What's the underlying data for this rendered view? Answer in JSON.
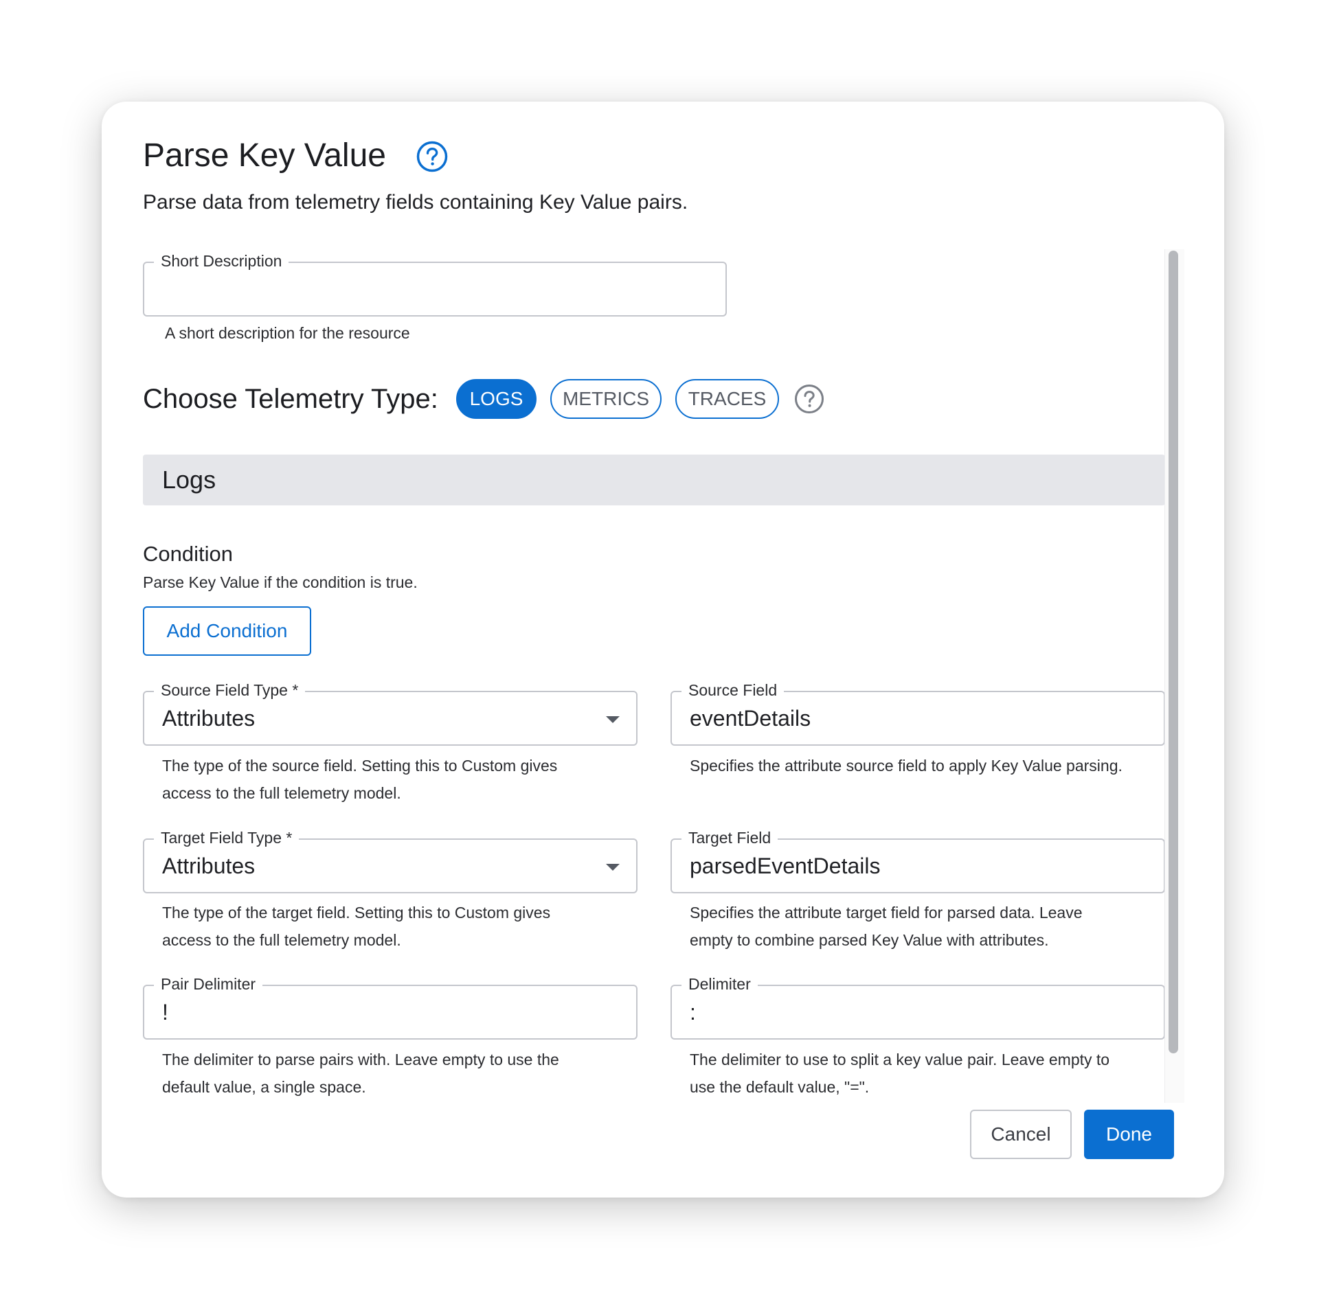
{
  "dialog": {
    "title": "Parse Key Value",
    "subtitle": "Parse data from telemetry fields containing Key Value pairs.",
    "help_icon": "question-circle-icon"
  },
  "short_description": {
    "label": "Short Description",
    "value": "",
    "helper": "A short description for the resource"
  },
  "telemetry": {
    "label": "Choose Telemetry Type:",
    "options": [
      "LOGS",
      "METRICS",
      "TRACES"
    ],
    "selected": "LOGS"
  },
  "section": {
    "title": "Logs"
  },
  "condition": {
    "title": "Condition",
    "description": "Parse Key Value if the condition is true.",
    "button_label": "Add Condition"
  },
  "fields": {
    "source_field_type": {
      "label": "Source Field Type *",
      "value": "Attributes",
      "helper_line1": "The type of the source field. Setting this to Custom gives",
      "helper_line2": "access to the full telemetry model."
    },
    "source_field": {
      "label": "Source Field",
      "value": "eventDetails",
      "helper_line1": "Specifies the attribute source field to apply Key Value parsing."
    },
    "target_field_type": {
      "label": "Target Field Type *",
      "value": "Attributes",
      "helper_line1": "The type of the target field. Setting this to Custom gives",
      "helper_line2": "access to the full telemetry model."
    },
    "target_field": {
      "label": "Target Field",
      "value": "parsedEventDetails",
      "helper_line1": "Specifies the attribute target field for parsed data. Leave",
      "helper_line2": "empty to combine parsed Key Value with attributes."
    },
    "pair_delimiter": {
      "label": "Pair Delimiter",
      "value": "!",
      "helper_line1": "The delimiter to parse pairs with. Leave empty to use the",
      "helper_line2": "default value, a single space."
    },
    "delimiter": {
      "label": "Delimiter",
      "value": ":",
      "helper_line1": "The delimiter to use to split a key value pair. Leave empty to",
      "helper_line2": "use the default value, \"=\"."
    }
  },
  "actions": {
    "cancel": "Cancel",
    "done": "Done"
  },
  "colors": {
    "accent": "#0b6fd1",
    "section_bg": "#e5e6ea",
    "border": "#c4c6cc"
  }
}
